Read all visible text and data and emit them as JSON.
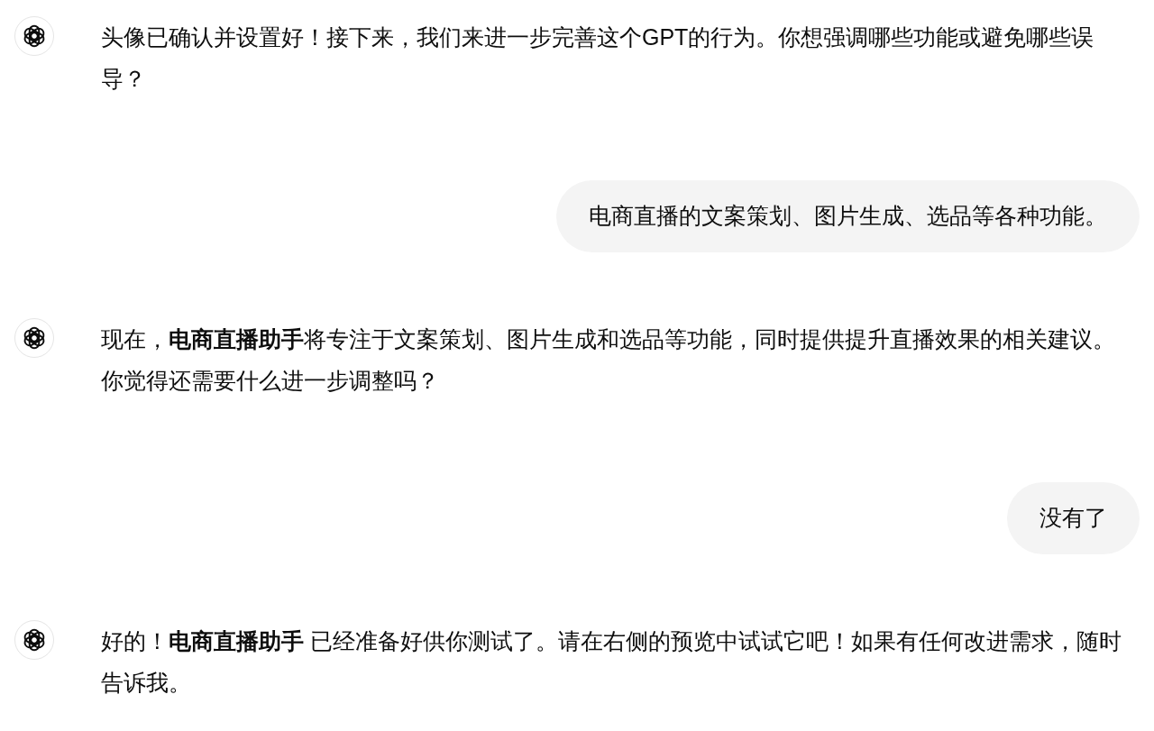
{
  "messages": [
    {
      "kind": "assistant",
      "text": "头像已确认并设置好！接下来，我们来进一步完善这个GPT的行为。你想强调哪些功能或避免哪些误导？"
    },
    {
      "kind": "user",
      "text": "电商直播的文案策划、图片生成、选品等各种功能。"
    },
    {
      "kind": "assistant",
      "text": "现在，**电商直播助手**将专注于文案策划、图片生成和选品等功能，同时提供提升直播效果的相关建议。你觉得还需要什么进一步调整吗？"
    },
    {
      "kind": "user",
      "text": "没有了"
    },
    {
      "kind": "assistant",
      "text": "好的！**电商直播助手** 已经准备好供你测试了。请在右侧的预览中试试它吧！如果有任何改进需求，随时告诉我。"
    }
  ]
}
